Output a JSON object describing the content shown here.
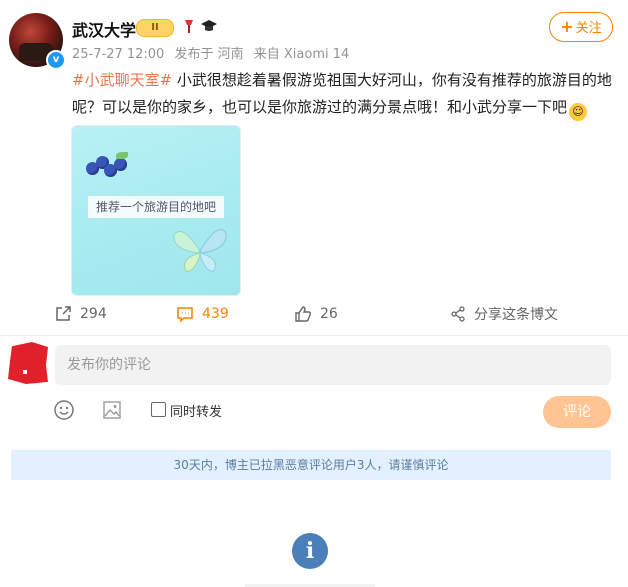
{
  "post": {
    "author": "武汉大学",
    "vip_badge": "II",
    "meta": {
      "timestamp": "25-7-27 12:00",
      "location": "发布于 河南",
      "source": "来自 Xiaomi 14"
    },
    "follow_label": "关注",
    "topic": "#小武聊天室#",
    "text": " 小武很想趁着暑假游览祖国大好河山，你有没有推荐的旅游目的地呢？可以是你的家乡，也可以是你旅游过的满分景点哦！和小武分享一下吧",
    "image_caption": "推荐一个旅游目的地吧",
    "actions": {
      "repost_count": "294",
      "comment_count": "439",
      "like_count": "26",
      "share_label": "分享这条博文"
    }
  },
  "composer": {
    "placeholder": "发布你的评论",
    "repost_label": "同时转发",
    "submit_label": "评论"
  },
  "notice": "30天内，博主已拉黑恶意评论用户3人，请谨慎评论",
  "colors": {
    "accent": "#ff8200",
    "topic": "#eb7350",
    "notice_bg": "#e3f0ff"
  },
  "icons": [
    "verified-icon",
    "vip-badge-icon",
    "torch-icon",
    "graduation-cap-icon",
    "repost-icon",
    "comment-icon",
    "like-icon",
    "share-icon",
    "emoji-icon",
    "image-icon",
    "info-icon"
  ]
}
